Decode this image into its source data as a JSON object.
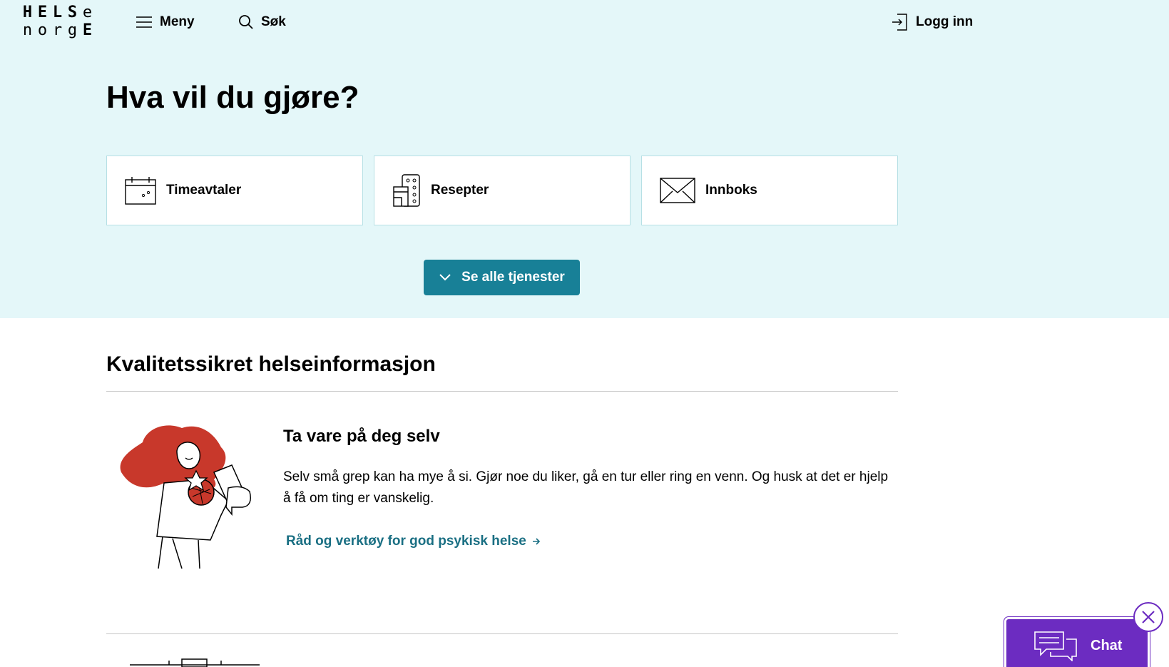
{
  "logo": {
    "row1": [
      "H",
      "E",
      "L",
      "S",
      "e"
    ],
    "row2": [
      "n",
      "o",
      "r",
      "g",
      "E"
    ]
  },
  "header": {
    "menu_label": "Meny",
    "search_label": "Søk",
    "login_label": "Logg inn"
  },
  "hero": {
    "title": "Hva vil du gjøre?",
    "cards": [
      {
        "label": "Timeavtaler",
        "icon": "calendar-icon"
      },
      {
        "label": "Resepter",
        "icon": "prescription-icon"
      },
      {
        "label": "Innboks",
        "icon": "envelope-icon"
      }
    ],
    "all_services_label": "Se alle tjenester"
  },
  "main": {
    "section_title": "Kvalitetssikret helseinformasjon",
    "article": {
      "title": "Ta vare på deg selv",
      "text": "Selv små grep kan ha mye å si. Gjør noe du liker, gå en tur eller ring en venn. Og husk at det er hjelp å få om ting er vanskelig.",
      "link_label": "Råd og verktøy for god psykisk helse"
    }
  },
  "chat": {
    "label": "Chat"
  },
  "colors": {
    "hero_bg": "#e4f7f9",
    "primary_button": "#188097",
    "link": "#1a6f83",
    "chat_purple": "#6c2cc1",
    "illustration_red": "#c8382b"
  }
}
